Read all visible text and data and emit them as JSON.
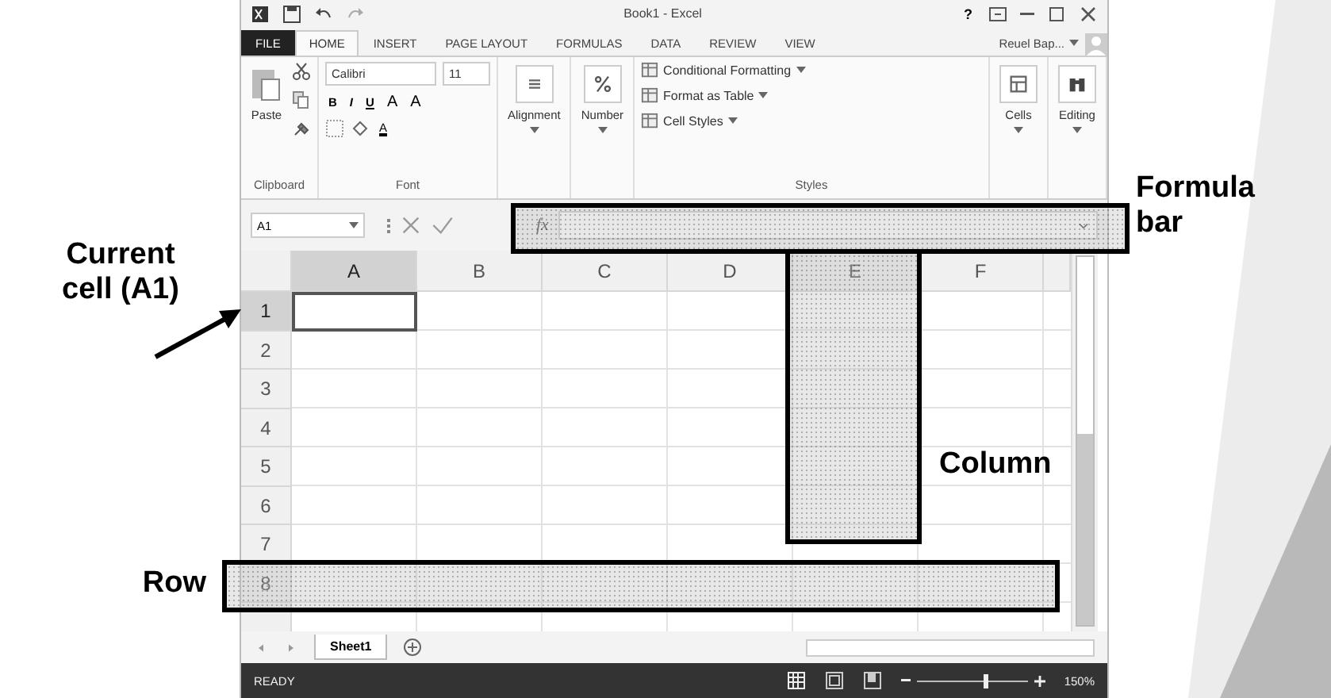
{
  "window": {
    "title": "Book1 - Excel",
    "help": "?"
  },
  "tabs": [
    {
      "label": "FILE",
      "kind": "file",
      "selected": false
    },
    {
      "label": "HOME",
      "kind": "tab",
      "selected": true
    },
    {
      "label": "INSERT",
      "kind": "tab",
      "selected": false
    },
    {
      "label": "PAGE LAYOUT",
      "kind": "tab",
      "selected": false
    },
    {
      "label": "FORMULAS",
      "kind": "tab",
      "selected": false
    },
    {
      "label": "DATA",
      "kind": "tab",
      "selected": false
    },
    {
      "label": "REVIEW",
      "kind": "tab",
      "selected": false
    },
    {
      "label": "VIEW",
      "kind": "tab",
      "selected": false
    }
  ],
  "account": {
    "name": "Reuel Bap..."
  },
  "ribbon": {
    "groups": [
      {
        "kind": "clipboard",
        "label": "Clipboard",
        "button": "Paste"
      },
      {
        "kind": "font",
        "label": "Font",
        "font": "Calibri",
        "size": "11",
        "format_buttons": [
          "B",
          "I",
          "U"
        ],
        "size_buttons": [
          "A",
          "A"
        ],
        "font_color": "A"
      },
      {
        "kind": "alignment",
        "button": "Alignment"
      },
      {
        "kind": "number",
        "button": "Number"
      },
      {
        "kind": "styles",
        "label": "Styles",
        "items": [
          "Conditional Formatting",
          "Format as Table",
          "Cell Styles"
        ]
      },
      {
        "kind": "cells",
        "button": "Cells"
      },
      {
        "kind": "editing",
        "button": "Editing"
      }
    ]
  },
  "formula_bar": {
    "name_box": "A1",
    "function_label": "fx"
  },
  "sheet": {
    "columns": [
      {
        "label": "A",
        "selected": true
      },
      {
        "label": "B",
        "selected": false
      },
      {
        "label": "C",
        "selected": false
      },
      {
        "label": "D",
        "selected": false
      },
      {
        "label": "E",
        "selected": false
      },
      {
        "label": "F",
        "selected": false
      }
    ],
    "rows": [
      {
        "label": "1",
        "selected": true
      },
      {
        "label": "2",
        "selected": false
      },
      {
        "label": "3",
        "selected": false
      },
      {
        "label": "4",
        "selected": false
      },
      {
        "label": "5",
        "selected": false
      },
      {
        "label": "6",
        "selected": false
      },
      {
        "label": "7",
        "selected": false
      },
      {
        "label": "8",
        "selected": false
      }
    ]
  },
  "sheet_tabs": [
    {
      "label": "Sheet1",
      "selected": true
    }
  ],
  "status_bar": {
    "text": "READY",
    "zoom": {
      "level": 0.6,
      "reading": "150%"
    }
  },
  "annotations": [
    {
      "kind": "box",
      "label": "Formula bar"
    },
    {
      "kind": "arrow",
      "label": "Current cell (A1)"
    },
    {
      "kind": "box",
      "label": "Column"
    },
    {
      "kind": "box",
      "label": "Row"
    }
  ]
}
